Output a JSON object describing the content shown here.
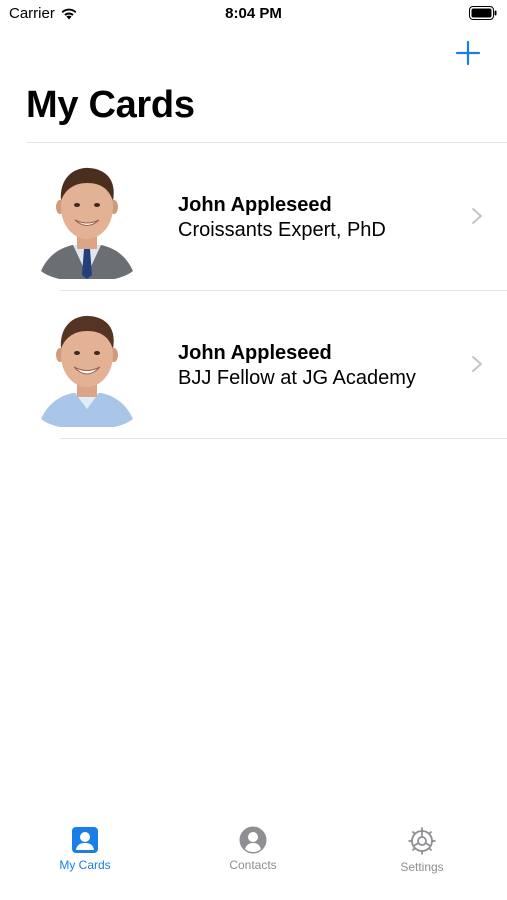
{
  "status_bar": {
    "carrier": "Carrier",
    "time": "8:04 PM"
  },
  "header": {
    "title": "My Cards",
    "add_icon": "plus-icon"
  },
  "cards": [
    {
      "name": "John Appleseed",
      "subtitle": "Croissants Expert, PhD",
      "avatar": "man-in-suit-photo"
    },
    {
      "name": "John Appleseed",
      "subtitle": "BJJ Fellow at JG Academy",
      "avatar": "man-in-casual-shirt-photo"
    }
  ],
  "tab_bar": {
    "tabs": [
      {
        "label": "My Cards",
        "icon": "person-card-icon",
        "active": true
      },
      {
        "label": "Contacts",
        "icon": "person-circle-icon",
        "active": false
      },
      {
        "label": "Settings",
        "icon": "gear-icon",
        "active": false
      }
    ]
  },
  "colors": {
    "accent": "#1a7ee6",
    "inactive": "#8e8e93",
    "divider": "#e4e4e6"
  }
}
